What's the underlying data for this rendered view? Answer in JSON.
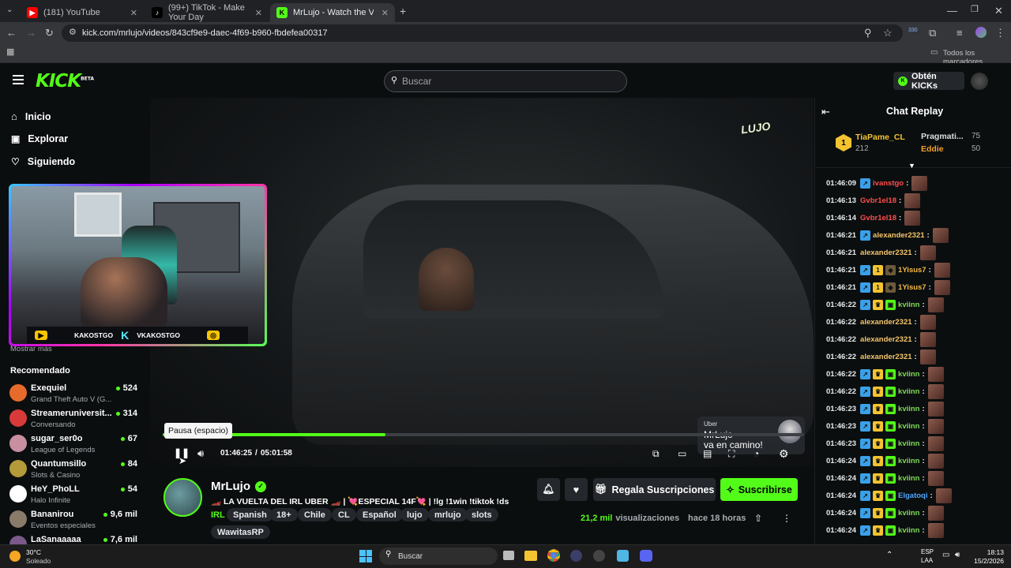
{
  "browser": {
    "tabs": [
      {
        "title": "(181) YouTube",
        "favicon": "youtube-icon",
        "color": "#ff0000"
      },
      {
        "title": "(99+) TikTok - Make Your Day",
        "favicon": "tiktok-icon",
        "color": "#000000"
      },
      {
        "title": "MrLujo - Watch the VOD o",
        "favicon": "kick-icon",
        "color": "#53fc18"
      }
    ],
    "url": "kick.com/mrlujo/videos/843cf9e9-daec-4f69-b960-fbdefea00317",
    "bookmarks_label": "Todos los marcadores",
    "extension_badge": "330"
  },
  "site": {
    "logo_text": "KICK",
    "logo_sup": "BETA",
    "search_placeholder": "Buscar",
    "kicks_label": "Obtén KICKs",
    "accent": "#53fc18"
  },
  "sidebar": {
    "nav": [
      {
        "label": "Inicio",
        "icon": "home-icon"
      },
      {
        "label": "Explorar",
        "icon": "compass-icon"
      },
      {
        "label": "Siguiendo",
        "icon": "heart-icon"
      }
    ],
    "show_more": "Mostrar más",
    "recommended_title": "Recomendado",
    "recommended": [
      {
        "name": "Exequiel",
        "category": "Grand Theft Auto V (G...",
        "viewers": "524",
        "color": "#e66b2b"
      },
      {
        "name": "Streameruniversit...",
        "category": "Conversando",
        "viewers": "314",
        "color": "#d83a3a"
      },
      {
        "name": "sugar_ser0o",
        "category": "League of Legends",
        "viewers": "67",
        "color": "#c78fa0"
      },
      {
        "name": "Quantumsillo",
        "category": "Slots & Casino",
        "viewers": "84",
        "color": "#b59a3a"
      },
      {
        "name": "HeY_PhoLL",
        "category": "Halo Infinite",
        "viewers": "54",
        "color": "#ffffff"
      },
      {
        "name": "Bananirou",
        "category": "Eventos especiales",
        "viewers": "9,6 mil",
        "color": "#8a7a6a"
      },
      {
        "name": "LaSanaaaaa",
        "category": "",
        "viewers": "7,6 mil",
        "color": "#7a5a8a"
      }
    ]
  },
  "player": {
    "overlay_logo": "LUJO",
    "cam_names": [
      "KAKOSTGO",
      "VKAKOSTGO"
    ],
    "tooltip": "Pausa (espacio)",
    "current_time": "01:46:25",
    "separator": "/",
    "duration": "05:01:58",
    "progress_fraction": 0.347,
    "ad_brand": "Uber",
    "ad_line1": "MrLujo",
    "ad_line2": "va en camino!"
  },
  "stream": {
    "channel_name": "MrLujo",
    "title": "🏎️ LA VUELTA DEL IRL UBER 🏎️ | 💘ESPECIAL 14F💘 | !lg !1win !tiktok !ds",
    "category": "IRL",
    "tags": [
      "Spanish",
      "18+",
      "Chile",
      "CL",
      "Español",
      "lujo",
      "mrlujo",
      "slots",
      "WawitasRP"
    ],
    "views_count": "21,2 mil",
    "views_label": "visualizaciones",
    "ago": "hace 18 horas",
    "gift_label": "Regala Suscripciones",
    "subscribe_label": "Suscribirse"
  },
  "chat": {
    "title": "Chat Replay",
    "top_gifter": {
      "name": "TiaPame_CL",
      "count": "212",
      "rank": "1"
    },
    "leaders": [
      {
        "name": "Pragmati...",
        "count": "75"
      },
      {
        "name": "Eddie",
        "count": "50"
      }
    ],
    "messages": [
      {
        "time": "01:46:09",
        "user": "ivanstgo",
        "color": "#ff4d4d",
        "badges": [
          "blue"
        ]
      },
      {
        "time": "01:46:13",
        "user": "Gvbr1el18",
        "color": "#ff4d4d",
        "badges": []
      },
      {
        "time": "01:46:14",
        "user": "Gvbr1el18",
        "color": "#ff4d4d",
        "badges": []
      },
      {
        "time": "01:46:21",
        "user": "alexander2321",
        "color": "#f4c56a",
        "badges": [
          "blue"
        ]
      },
      {
        "time": "01:46:21",
        "user": "alexander2321",
        "color": "#f4c56a",
        "badges": []
      },
      {
        "time": "01:46:21",
        "user": "1Yisus7",
        "color": "#f4b942",
        "badges": [
          "blue",
          "gold",
          "shield"
        ]
      },
      {
        "time": "01:46:21",
        "user": "1Yisus7",
        "color": "#f4b942",
        "badges": [
          "blue",
          "gold",
          "shield"
        ]
      },
      {
        "time": "01:46:22",
        "user": "kviinn",
        "color": "#7ed957",
        "badges": [
          "blue",
          "crown",
          "gift"
        ]
      },
      {
        "time": "01:46:22",
        "user": "alexander2321",
        "color": "#f4c56a",
        "badges": []
      },
      {
        "time": "01:46:22",
        "user": "alexander2321",
        "color": "#f4c56a",
        "badges": []
      },
      {
        "time": "01:46:22",
        "user": "alexander2321",
        "color": "#f4c56a",
        "badges": []
      },
      {
        "time": "01:46:22",
        "user": "kviinn",
        "color": "#7ed957",
        "badges": [
          "blue",
          "crown",
          "gift"
        ]
      },
      {
        "time": "01:46:22",
        "user": "kviinn",
        "color": "#7ed957",
        "badges": [
          "blue",
          "crown",
          "gift"
        ]
      },
      {
        "time": "01:46:23",
        "user": "kviinn",
        "color": "#7ed957",
        "badges": [
          "blue",
          "crown",
          "gift"
        ]
      },
      {
        "time": "01:46:23",
        "user": "kviinn",
        "color": "#7ed957",
        "badges": [
          "blue",
          "crown",
          "gift"
        ]
      },
      {
        "time": "01:46:23",
        "user": "kviinn",
        "color": "#7ed957",
        "badges": [
          "blue",
          "crown",
          "gift"
        ]
      },
      {
        "time": "01:46:24",
        "user": "kviinn",
        "color": "#7ed957",
        "badges": [
          "blue",
          "crown",
          "gift"
        ]
      },
      {
        "time": "01:46:24",
        "user": "kviinn",
        "color": "#7ed957",
        "badges": [
          "blue",
          "crown",
          "gift"
        ]
      },
      {
        "time": "01:46:24",
        "user": "Elgatoqi",
        "color": "#4da6ff",
        "badges": [
          "blue",
          "crown",
          "gift"
        ]
      },
      {
        "time": "01:46:24",
        "user": "kviinn",
        "color": "#7ed957",
        "badges": [
          "blue",
          "crown",
          "gift"
        ]
      },
      {
        "time": "01:46:24",
        "user": "kviinn",
        "color": "#7ed957",
        "badges": [
          "blue",
          "crown",
          "gift"
        ]
      }
    ]
  },
  "taskbar": {
    "weather_temp": "30°C",
    "weather_desc": "Soleado",
    "search_label": "Buscar",
    "lang1": "ESP",
    "lang2": "LAA",
    "time": "18:13",
    "date": "15/2/2026"
  }
}
